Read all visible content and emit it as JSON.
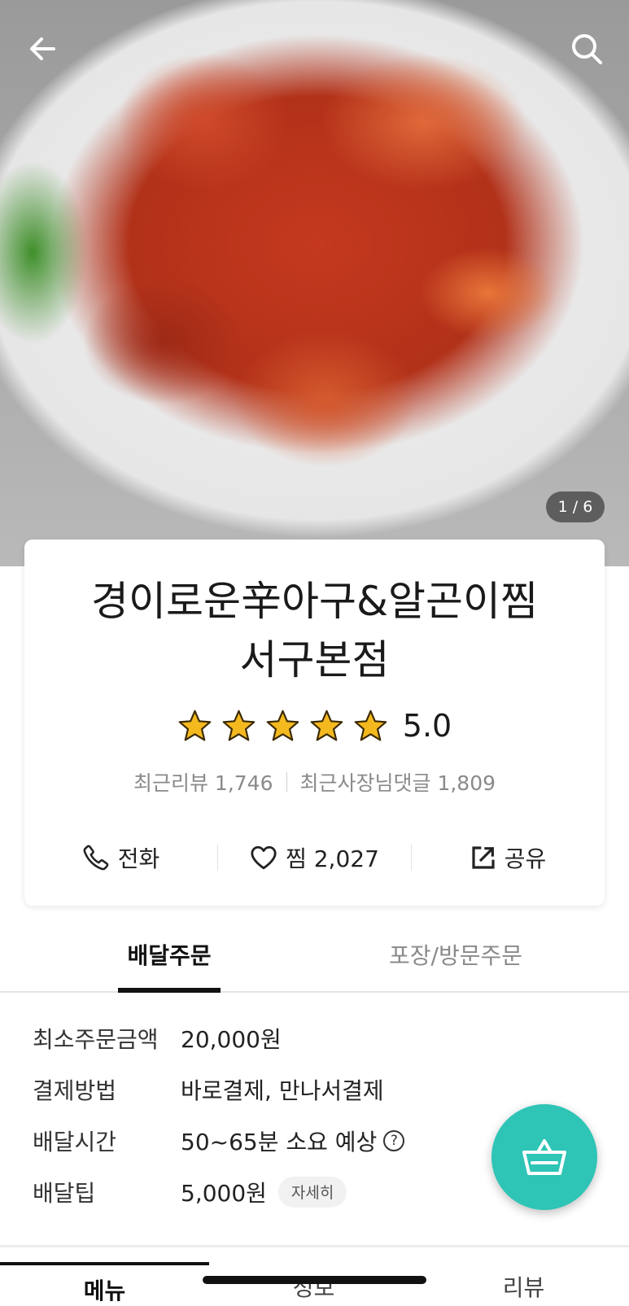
{
  "hero": {
    "image_counter": "1 / 6",
    "back_icon": "arrow-left-icon",
    "search_icon": "search-icon"
  },
  "store": {
    "name_line1": "경이로운辛아구&알곤이찜",
    "name_line2": "서구본점",
    "rating": "5.0",
    "stars": 5,
    "recent_reviews": "최근리뷰 1,746",
    "owner_replies": "최근사장님댓글 1,809"
  },
  "actions": {
    "call_label": "전화",
    "favorite_label": "찜 2,027",
    "share_label": "공유"
  },
  "order_tabs": {
    "delivery": "배달주문",
    "pickup": "포장/방문주문"
  },
  "delivery_info": {
    "min_order_label": "최소주문금액",
    "min_order_value": "20,000원",
    "payment_label": "결제방법",
    "payment_value": "바로결제, 만나서결제",
    "time_label": "배달시간",
    "time_value": "50~65분 소요 예상",
    "tip_label": "배달팁",
    "tip_value": "5,000원",
    "tip_detail": "자세히"
  },
  "bottom_tabs": {
    "menu": "메뉴",
    "info": "정보",
    "review": "리뷰"
  },
  "colors": {
    "accent": "#2ec4b6",
    "star": "#f5b920"
  }
}
